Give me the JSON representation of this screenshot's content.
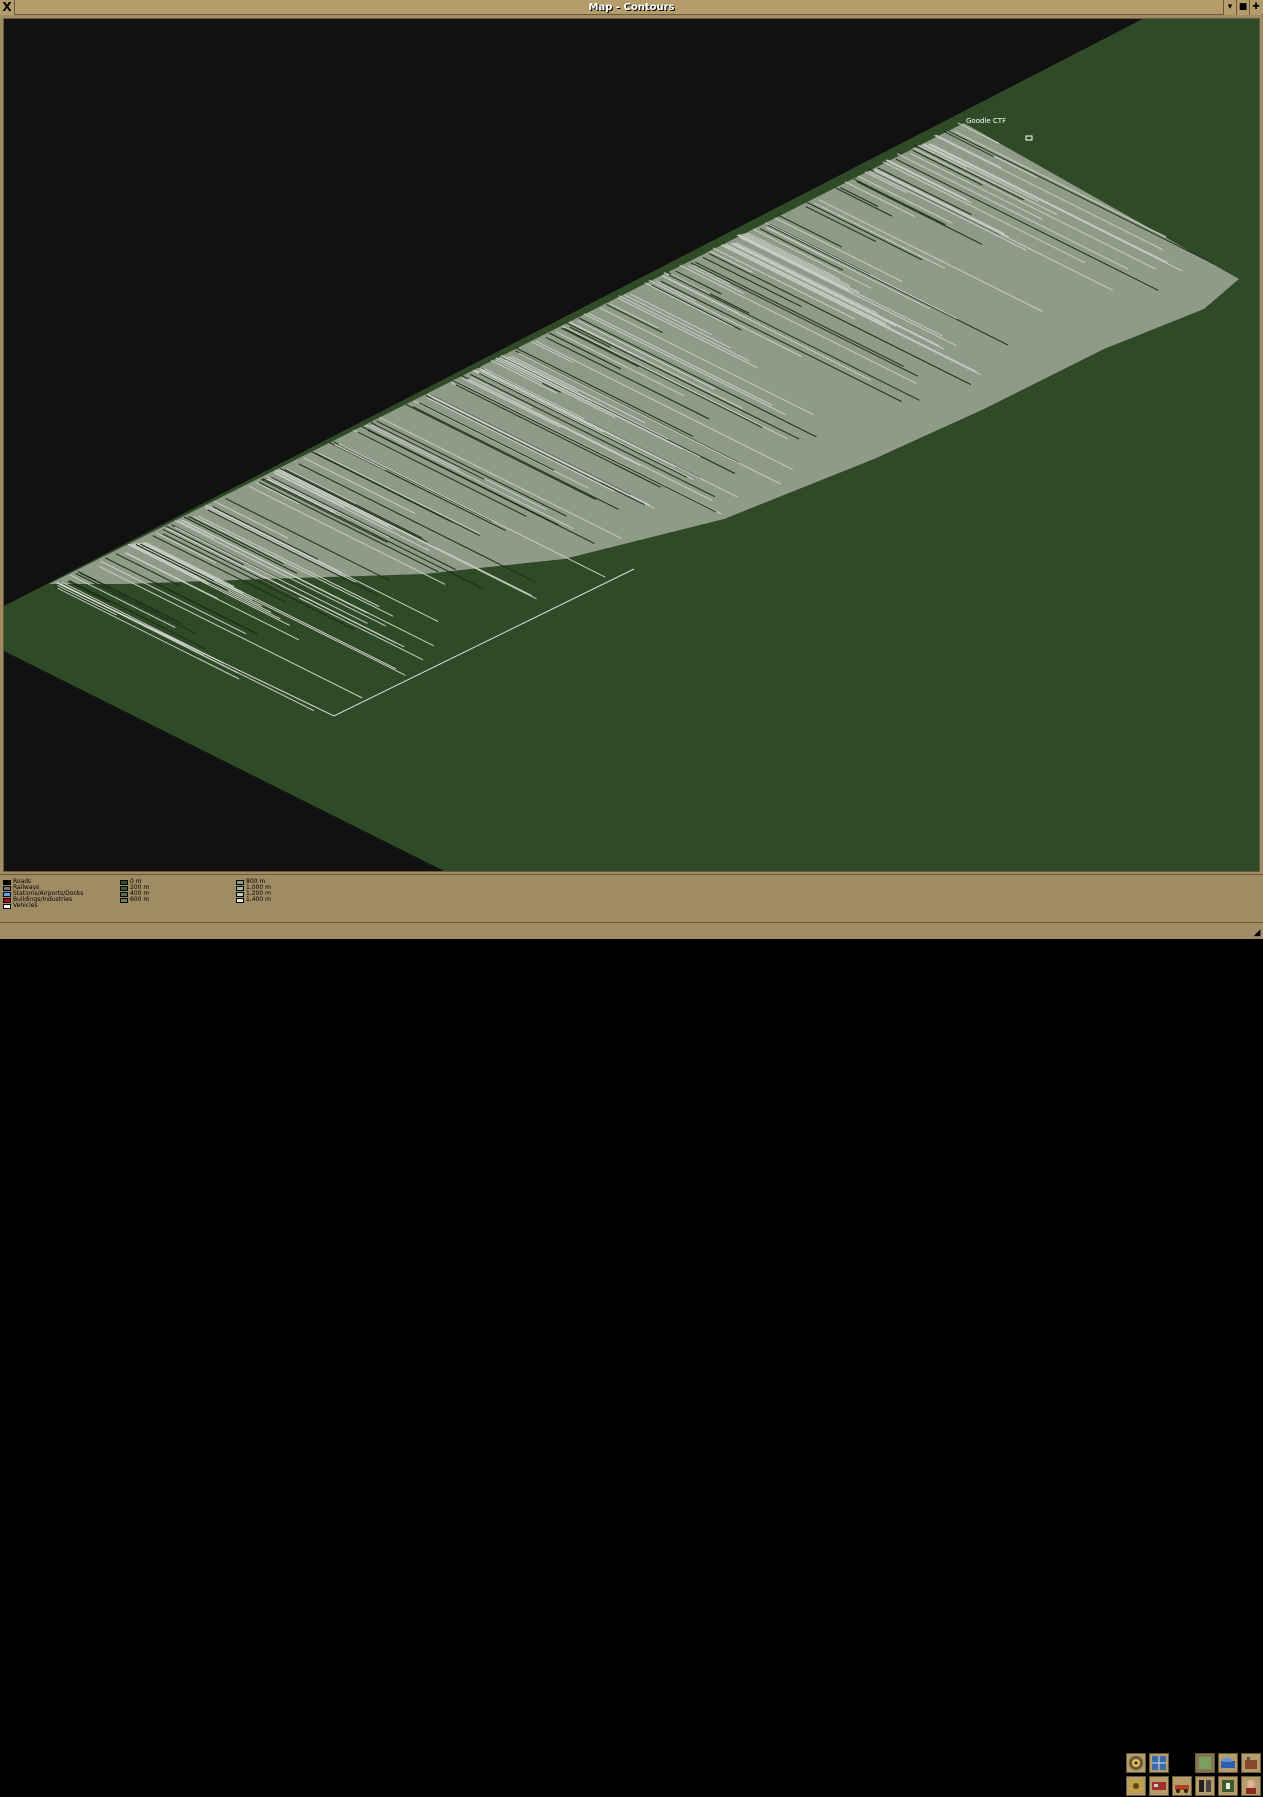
{
  "window": {
    "title": "Map - Contours",
    "close_label": "X",
    "shade_label": "▾",
    "defsize_label": "■",
    "sticky_label": "✚"
  },
  "map": {
    "town_label": "Goodle CTF",
    "colors": {
      "void": "#111111",
      "land": "#2f4a26",
      "highland": "#8f9a88",
      "ridge_light": "#c8cec3",
      "ridge_dark": "#1b2b16",
      "viewport_outline": "#dcdcdc"
    }
  },
  "legend": {
    "categories": [
      {
        "label": "Roads",
        "color": "#000000"
      },
      {
        "label": "Railways",
        "color": "#7c7c7c"
      },
      {
        "label": "Stations/Airports/Docks",
        "color": "#5fa0ff"
      },
      {
        "label": "Buildings/Industries",
        "color": "#b8001c"
      },
      {
        "label": "Vehicles",
        "color": "#ffffff"
      }
    ],
    "heights_low": [
      {
        "label": "0 m",
        "color": "#2f4a26"
      },
      {
        "label": "200 m",
        "color": "#3f5a34"
      },
      {
        "label": "400 m",
        "color": "#546e48"
      },
      {
        "label": "600 m",
        "color": "#6c8462"
      }
    ],
    "heights_high": [
      {
        "label": "800 m",
        "color": "#88a07c"
      },
      {
        "label": "1,000 m",
        "color": "#a4b89a"
      },
      {
        "label": "1,200 m",
        "color": "#c2d0b8"
      },
      {
        "label": "1,400 m",
        "color": "#e4ecdc"
      }
    ]
  },
  "toolbar": {
    "row1": [
      "contours-icon",
      "vegetation-icon",
      "blank",
      "owners-icon",
      "routes-icon",
      "industries-icon"
    ],
    "row2": [
      "linkstats-icon",
      "trains-icon",
      "road-vehicles-icon",
      "toggle-town-names-icon",
      "center-icon",
      "show-owner-icon"
    ]
  }
}
